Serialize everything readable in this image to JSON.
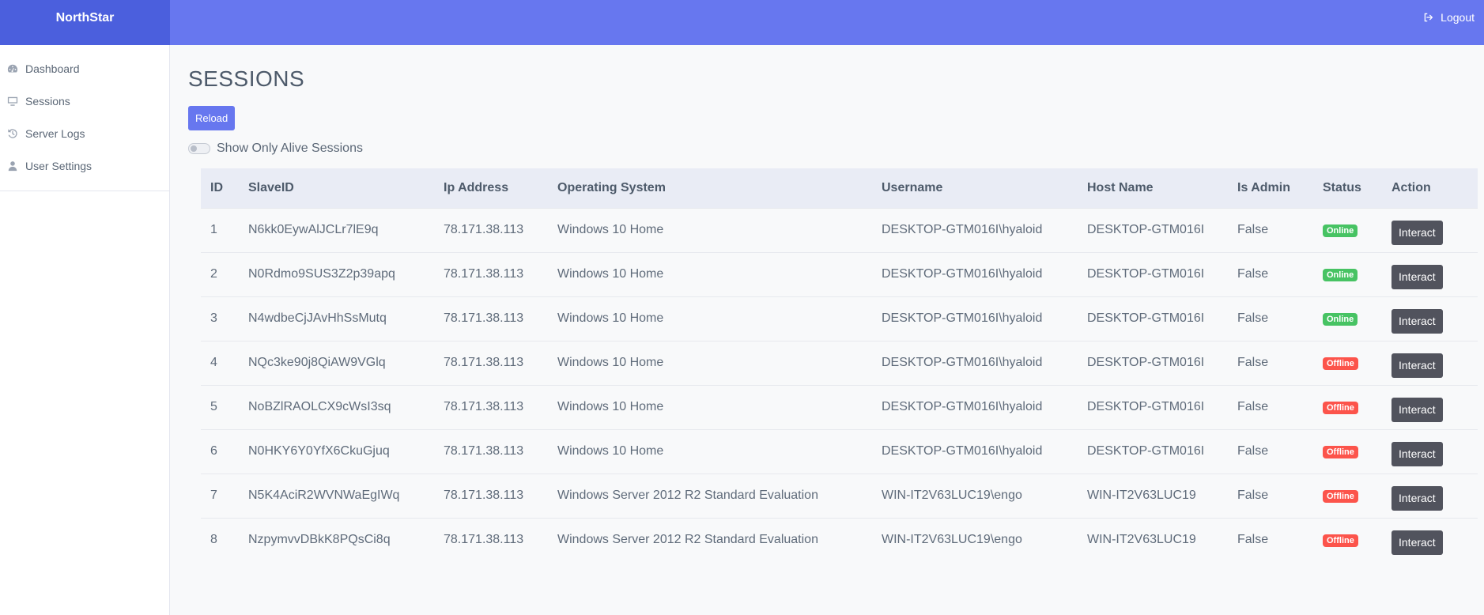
{
  "app": {
    "brand": "NorthStar",
    "logout_label": "Logout"
  },
  "sidebar": {
    "items": [
      {
        "label": "Dashboard",
        "icon": "dashboard-icon"
      },
      {
        "label": "Sessions",
        "icon": "monitor-icon"
      },
      {
        "label": "Server Logs",
        "icon": "history-icon"
      },
      {
        "label": "User Settings",
        "icon": "user-icon"
      }
    ]
  },
  "main": {
    "title": "SESSIONS",
    "reload_label": "Reload",
    "toggle_label": "Show Only Alive Sessions",
    "toggle_on": false
  },
  "table": {
    "columns": [
      "ID",
      "SlaveID",
      "Ip Address",
      "Operating System",
      "Username",
      "Host Name",
      "Is Admin",
      "Status",
      "Action"
    ],
    "rows": [
      {
        "id": "1",
        "slave_id": "N6kk0EywAlJCLr7lE9q",
        "ip": "78.171.38.113",
        "os": "Windows 10 Home",
        "username": "DESKTOP-GTM016I\\hyaloid",
        "host": "DESKTOP-GTM016I",
        "is_admin": "False",
        "status": "Online",
        "action": "Interact"
      },
      {
        "id": "2",
        "slave_id": "N0Rdmo9SUS3Z2p39apq",
        "ip": "78.171.38.113",
        "os": "Windows 10 Home",
        "username": "DESKTOP-GTM016I\\hyaloid",
        "host": "DESKTOP-GTM016I",
        "is_admin": "False",
        "status": "Online",
        "action": "Interact"
      },
      {
        "id": "3",
        "slave_id": "N4wdbeCjJAvHhSsMutq",
        "ip": "78.171.38.113",
        "os": "Windows 10 Home",
        "username": "DESKTOP-GTM016I\\hyaloid",
        "host": "DESKTOP-GTM016I",
        "is_admin": "False",
        "status": "Online",
        "action": "Interact"
      },
      {
        "id": "4",
        "slave_id": "NQc3ke90j8QiAW9VGlq",
        "ip": "78.171.38.113",
        "os": "Windows 10 Home",
        "username": "DESKTOP-GTM016I\\hyaloid",
        "host": "DESKTOP-GTM016I",
        "is_admin": "False",
        "status": "Offline",
        "action": "Interact"
      },
      {
        "id": "5",
        "slave_id": "NoBZlRAOLCX9cWsI3sq",
        "ip": "78.171.38.113",
        "os": "Windows 10 Home",
        "username": "DESKTOP-GTM016I\\hyaloid",
        "host": "DESKTOP-GTM016I",
        "is_admin": "False",
        "status": "Offline",
        "action": "Interact"
      },
      {
        "id": "6",
        "slave_id": "N0HKY6Y0YfX6CkuGjuq",
        "ip": "78.171.38.113",
        "os": "Windows 10 Home",
        "username": "DESKTOP-GTM016I\\hyaloid",
        "host": "DESKTOP-GTM016I",
        "is_admin": "False",
        "status": "Offline",
        "action": "Interact"
      },
      {
        "id": "7",
        "slave_id": "N5K4AciR2WVNWaEgIWq",
        "ip": "78.171.38.113",
        "os": "Windows Server 2012 R2 Standard Evaluation",
        "username": "WIN-IT2V63LUC19\\engo",
        "host": "WIN-IT2V63LUC19",
        "is_admin": "False",
        "status": "Offline",
        "action": "Interact"
      },
      {
        "id": "8",
        "slave_id": "NzpymvvDBkK8PQsCi8q",
        "ip": "78.171.38.113",
        "os": "Windows Server 2012 R2 Standard Evaluation",
        "username": "WIN-IT2V63LUC19\\engo",
        "host": "WIN-IT2V63LUC19",
        "is_admin": "False",
        "status": "Offline",
        "action": "Interact"
      }
    ]
  },
  "colors": {
    "brand": "#4b5fdd",
    "topbar": "#6777ef",
    "online": "#47c363",
    "offline": "#fc544b",
    "interact_button": "#51535d"
  }
}
